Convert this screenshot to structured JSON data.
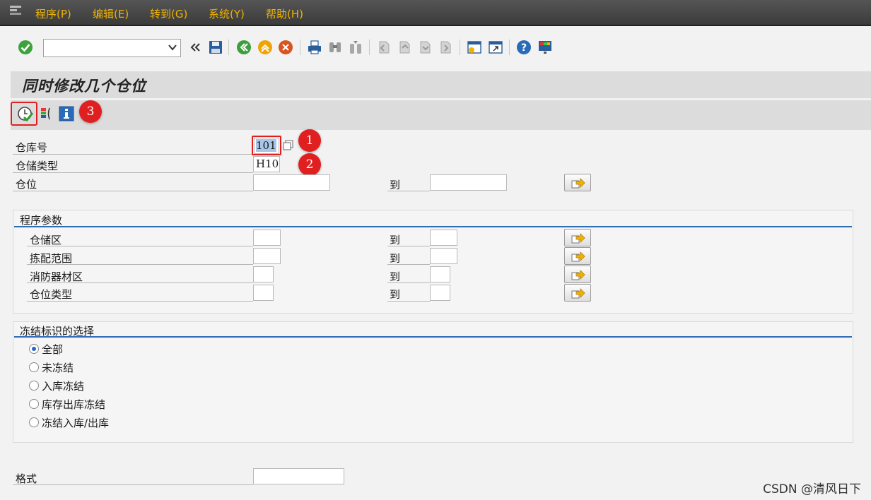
{
  "menu": {
    "items": [
      "程序(P)",
      "编辑(E)",
      "转到(G)",
      "系统(Y)",
      "帮助(H)"
    ]
  },
  "toolbar": {
    "command_field_value": "",
    "icons": [
      "enter-check-icon",
      "command-field",
      "back-double-arrow-icon",
      "save-icon",
      "back-icon",
      "exit-icon",
      "cancel-icon",
      "print-icon",
      "find-icon",
      "find-next-icon",
      "first-page-icon",
      "previous-page-icon",
      "next-page-icon",
      "last-page-icon",
      "create-session-icon",
      "generate-shortcut-icon",
      "help-icon",
      "customize-layout-icon"
    ]
  },
  "page": {
    "title": "同时修改几个仓位"
  },
  "app_toolbar": {
    "icons": [
      "execute-icon",
      "variant-list-icon",
      "info-icon"
    ]
  },
  "badges": {
    "b1": "1",
    "b2": "2",
    "b3": "3"
  },
  "selection": {
    "warehouse_label": "仓库号",
    "warehouse_value": "101",
    "storage_type_label": "仓储类型",
    "storage_type_value": "H10",
    "bin_label": "仓位",
    "bin_from": "",
    "bin_to": "",
    "to_label": "到"
  },
  "program_params": {
    "title": "程序参数",
    "rows": [
      {
        "label": "仓储区",
        "from": "",
        "to": ""
      },
      {
        "label": "拣配范围",
        "from": "",
        "to": ""
      },
      {
        "label": "消防器材区",
        "from": "",
        "to": ""
      },
      {
        "label": "仓位类型",
        "from": "",
        "to": ""
      }
    ],
    "to_label": "到"
  },
  "freeze": {
    "title": "冻结标识的选择",
    "options": [
      "全部",
      "未冻结",
      "入库冻结",
      "库存出库冻结",
      "冻结入库/出库"
    ],
    "selected_index": 0
  },
  "format": {
    "label": "格式",
    "value": ""
  },
  "watermark": "CSDN @清风日下",
  "colors": {
    "menu_text": "#f0b400",
    "badge": "#e02020",
    "highlight_box": "#e02020",
    "group_line": "#2f6db5"
  }
}
